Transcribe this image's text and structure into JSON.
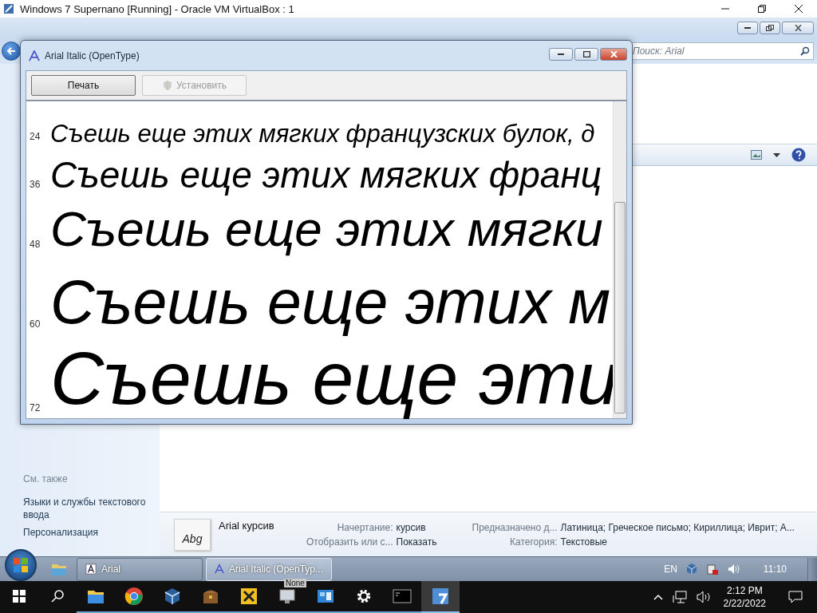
{
  "host_window": {
    "title": "Windows 7 Supernano [Running] - Oracle VM VirtualBox : 1"
  },
  "explorer": {
    "search": {
      "placeholder": "Поиск: Arial"
    },
    "see_also": {
      "heading": "См. также",
      "links": [
        "Языки и службы текстового ввода",
        "Персонализация"
      ]
    },
    "details": {
      "thumbnail_text": "Abg",
      "name": "Arial курсив",
      "fields": [
        {
          "label": "Начертание:",
          "value": "курсив"
        },
        {
          "label": "Отобразить или с...",
          "value": "Показать"
        },
        {
          "label": "Предназначено д...",
          "value": "Латиница; Греческое письмо; Кириллица; Иврит; А..."
        },
        {
          "label": "Категория:",
          "value": "Текстовые"
        }
      ]
    }
  },
  "font_window": {
    "title": "Arial Italic (OpenType)",
    "buttons": [
      {
        "label": "Печать",
        "disabled": false
      },
      {
        "label": "Установить",
        "disabled": true
      }
    ],
    "samples": [
      {
        "size": "24",
        "text": "Съешь еще этих мягких французских булок, д"
      },
      {
        "size": "36",
        "text": "Съешь еще этих мягких франц"
      },
      {
        "size": "48",
        "text": "Съешь еще этих мягки"
      },
      {
        "size": "60",
        "text": "Съешь еще этих м"
      },
      {
        "size": "72",
        "text": "Съешь еще эти"
      }
    ]
  },
  "vm_taskbar": {
    "tasks": [
      {
        "label": "Arial",
        "selected": false
      },
      {
        "label": "Arial Italic (OpenTyp...",
        "selected": true
      }
    ],
    "language": "EN",
    "clock": "11:10"
  },
  "host_taskbar": {
    "apps": [
      {
        "kind": "explorer",
        "selected": false
      },
      {
        "kind": "chrome",
        "selected": false
      },
      {
        "kind": "virtualbox",
        "selected": false
      },
      {
        "kind": "chest",
        "selected": false
      },
      {
        "kind": "yellow",
        "selected": false
      },
      {
        "kind": "monitor",
        "selected": false
      },
      {
        "kind": "panel",
        "selected": false
      },
      {
        "kind": "gear",
        "selected": false
      },
      {
        "kind": "terminal",
        "selected": false
      },
      {
        "kind": "win7",
        "selected": true
      }
    ],
    "tooltip": "None",
    "time": "2:12 PM",
    "date": "2/22/2022"
  }
}
